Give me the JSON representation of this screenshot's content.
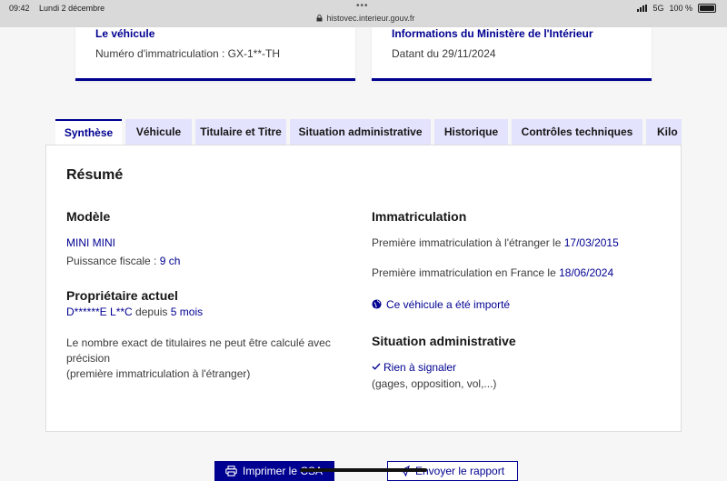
{
  "status_bar": {
    "time": "09:42",
    "date": "Lundi 2 décembre",
    "url": "histovec.interieur.gouv.fr",
    "network": "5G",
    "battery": "100 %"
  },
  "cards": [
    {
      "title": "Le véhicule",
      "subtitle": "Numéro d'immatriculation : GX-1**-TH"
    },
    {
      "title": "Informations du Ministère de l'Intérieur",
      "subtitle": "Datant du 29/11/2024"
    }
  ],
  "tabs": [
    {
      "label": "Synthèse",
      "active": true
    },
    {
      "label": "Véhicule"
    },
    {
      "label": "Titulaire et Titre"
    },
    {
      "label": "Situation administrative"
    },
    {
      "label": "Historique"
    },
    {
      "label": "Contrôles techniques"
    },
    {
      "label": "Kilo"
    }
  ],
  "summary": {
    "title": "Résumé",
    "model": {
      "heading": "Modèle",
      "name": "MINI MINI",
      "power_label": "Puissance fiscale :",
      "power_value": "9 ch"
    },
    "owner": {
      "heading": "Propriétaire actuel",
      "name": "D******E L**C",
      "since_label": "depuis",
      "since_value": "5 mois",
      "note_line1": "Le nombre exact de titulaires ne peut être calculé avec",
      "note_line2": "précision",
      "note_line3": "(première immatriculation à l'étranger)"
    },
    "registration": {
      "heading": "Immatriculation",
      "foreign_label": "Première immatriculation à l'étranger le",
      "foreign_date": "17/03/2015",
      "france_label": "Première immatriculation en France le",
      "france_date": "18/06/2024",
      "imported": "Ce véhicule a été importé"
    },
    "admin": {
      "heading": "Situation administrative",
      "status": "Rien à signaler",
      "details": "(gages, opposition, vol,...)"
    }
  },
  "actions": {
    "print": "Imprimer le CSA",
    "send": "Envoyer le rapport"
  },
  "colors": {
    "primary": "#000091",
    "tab_bg": "#e3e3fd"
  }
}
